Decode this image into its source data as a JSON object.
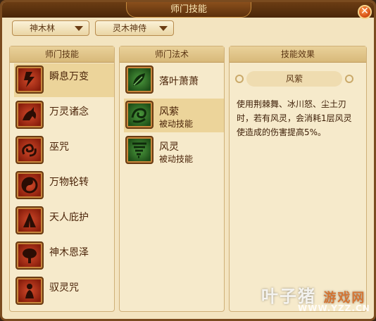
{
  "window": {
    "title": "师门技能",
    "close_label": "✕"
  },
  "dropdowns": [
    {
      "label": "神木林"
    },
    {
      "label": "灵木神侍"
    }
  ],
  "skills_panel": {
    "header": "师门技能",
    "items": [
      {
        "label": "瞬息万变",
        "icon": "lightning-icon"
      },
      {
        "label": "万灵诸念",
        "icon": "beast-icon"
      },
      {
        "label": "巫咒",
        "icon": "curse-icon"
      },
      {
        "label": "万物轮转",
        "icon": "yin-yang-icon"
      },
      {
        "label": "天人庇护",
        "icon": "praying-hands-icon"
      },
      {
        "label": "神木恩泽",
        "icon": "tree-icon"
      },
      {
        "label": "驭灵咒",
        "icon": "spirit-icon"
      }
    ]
  },
  "spells_panel": {
    "header": "师门法术",
    "items": [
      {
        "label": "落叶萧萧",
        "sub": "",
        "icon": "leaf-icon"
      },
      {
        "label": "风萦",
        "sub": "被动技能",
        "icon": "wind-swirl-icon"
      },
      {
        "label": "风灵",
        "sub": "被动技能",
        "icon": "tornado-icon"
      }
    ]
  },
  "effect_panel": {
    "header": "技能效果",
    "name": "风萦",
    "description": "使用荆棘舞、冰川怒、尘土刃时，若有风灵，会消耗1层风灵使造成的伤害提高5%。"
  },
  "watermark": {
    "text_a": "叶子猪",
    "text_b": "游戏网",
    "url": "WWW.YZZ.CN"
  }
}
